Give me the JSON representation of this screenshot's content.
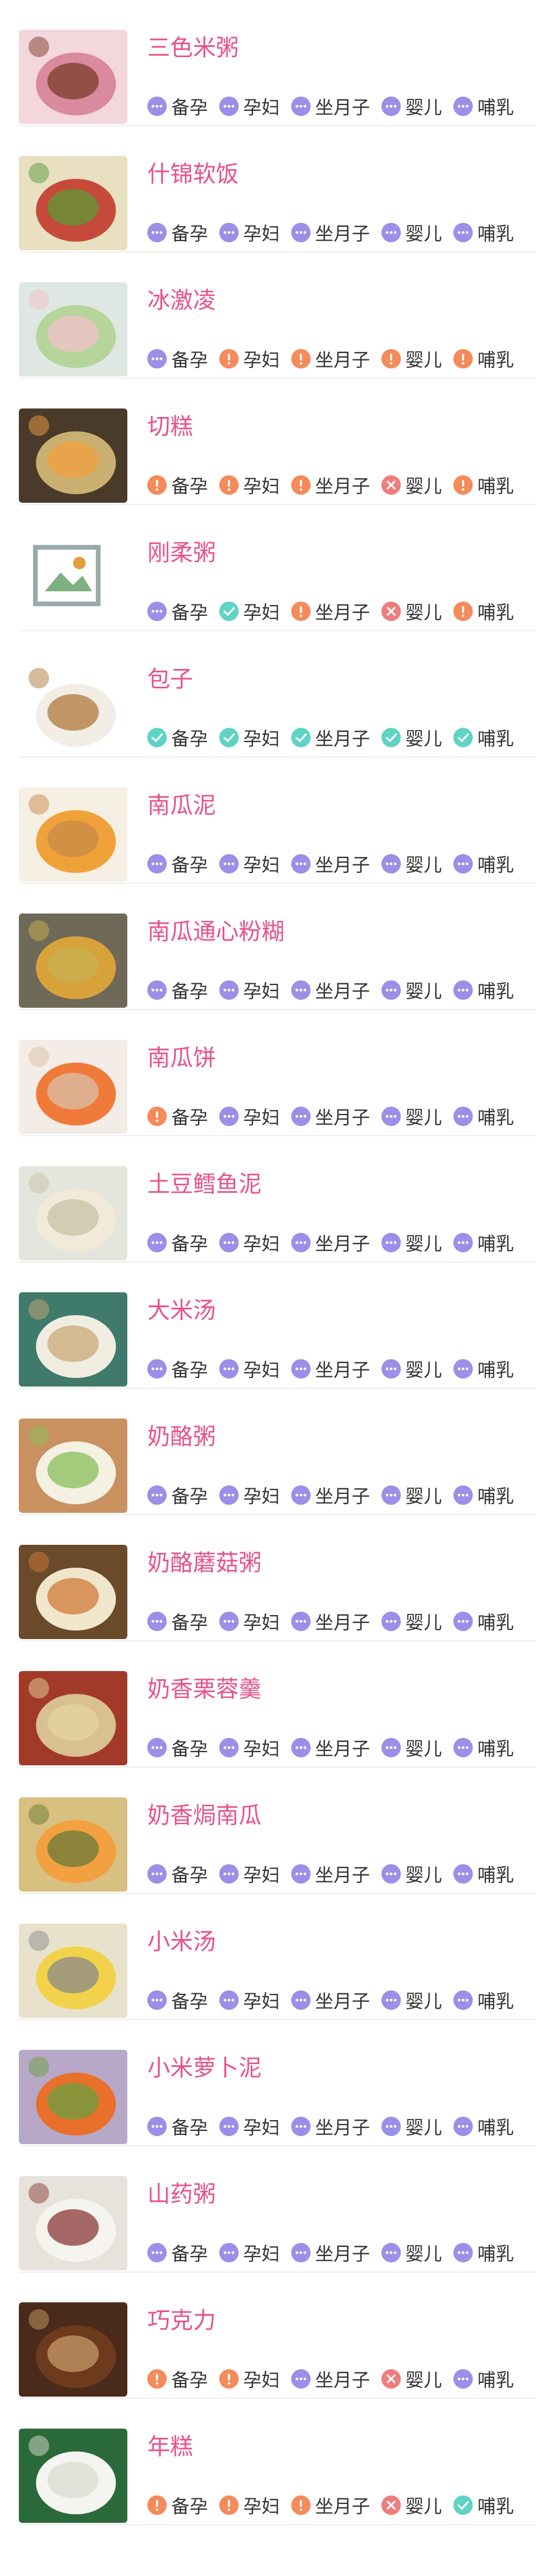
{
  "status_colors": {
    "ok": "#9b8fe8",
    "yes": "#5fd3c4",
    "warn": "#f58a5a",
    "no": "#ee7d7d"
  },
  "title_color": "#e8528a",
  "groups": [
    "备孕",
    "孕妇",
    "坐月子",
    "婴儿",
    "哺乳"
  ],
  "foods": [
    {
      "name": "三色米粥",
      "image": "rice-porridge-photo",
      "statuses": [
        "ok",
        "ok",
        "ok",
        "ok",
        "ok"
      ]
    },
    {
      "name": "什锦软饭",
      "image": "mixed-rice-photo",
      "statuses": [
        "ok",
        "ok",
        "ok",
        "ok",
        "ok"
      ]
    },
    {
      "name": "冰激凌",
      "image": "ice-cream-photo",
      "statuses": [
        "ok",
        "warn",
        "warn",
        "warn",
        "warn"
      ]
    },
    {
      "name": "切糕",
      "image": "nut-cake-photo",
      "statuses": [
        "warn",
        "warn",
        "warn",
        "no",
        "warn"
      ]
    },
    {
      "name": "刚柔粥",
      "image": "broken-image",
      "statuses": [
        "ok",
        "yes",
        "warn",
        "no",
        "warn"
      ]
    },
    {
      "name": "包子",
      "image": "steamed-buns-photo",
      "statuses": [
        "yes",
        "yes",
        "yes",
        "yes",
        "yes"
      ]
    },
    {
      "name": "南瓜泥",
      "image": "pumpkin-puree-photo",
      "statuses": [
        "ok",
        "ok",
        "ok",
        "ok",
        "ok"
      ]
    },
    {
      "name": "南瓜通心粉糊",
      "image": "pumpkin-pasta-photo",
      "statuses": [
        "ok",
        "ok",
        "ok",
        "ok",
        "ok"
      ]
    },
    {
      "name": "南瓜饼",
      "image": "pumpkin-cake-photo",
      "statuses": [
        "warn",
        "ok",
        "ok",
        "ok",
        "ok"
      ]
    },
    {
      "name": "土豆鳕鱼泥",
      "image": "cod-fish-photo",
      "statuses": [
        "ok",
        "ok",
        "ok",
        "ok",
        "ok"
      ]
    },
    {
      "name": "大米汤",
      "image": "rice-soup-photo",
      "statuses": [
        "ok",
        "ok",
        "ok",
        "ok",
        "ok"
      ]
    },
    {
      "name": "奶酪粥",
      "image": "cheese-porridge-photo",
      "statuses": [
        "ok",
        "ok",
        "ok",
        "ok",
        "ok"
      ]
    },
    {
      "name": "奶酪蘑菇粥",
      "image": "mushroom-porridge-photo",
      "statuses": [
        "ok",
        "ok",
        "ok",
        "ok",
        "ok"
      ]
    },
    {
      "name": "奶香栗蓉羹",
      "image": "chestnut-soup-photo",
      "statuses": [
        "ok",
        "ok",
        "ok",
        "ok",
        "ok"
      ]
    },
    {
      "name": "奶香焗南瓜",
      "image": "baked-pumpkin-photo",
      "statuses": [
        "ok",
        "ok",
        "ok",
        "ok",
        "ok"
      ]
    },
    {
      "name": "小米汤",
      "image": "millet-soup-photo",
      "statuses": [
        "ok",
        "ok",
        "ok",
        "ok",
        "ok"
      ]
    },
    {
      "name": "小米萝卜泥",
      "image": "carrot-puree-photo",
      "statuses": [
        "ok",
        "ok",
        "ok",
        "ok",
        "ok"
      ]
    },
    {
      "name": "山药粥",
      "image": "yam-porridge-photo",
      "statuses": [
        "ok",
        "ok",
        "ok",
        "ok",
        "ok"
      ]
    },
    {
      "name": "巧克力",
      "image": "chocolate-photo",
      "statuses": [
        "warn",
        "warn",
        "ok",
        "no",
        "ok"
      ]
    },
    {
      "name": "年糕",
      "image": "rice-cake-photo",
      "statuses": [
        "warn",
        "warn",
        "warn",
        "no",
        "yes"
      ]
    }
  ]
}
